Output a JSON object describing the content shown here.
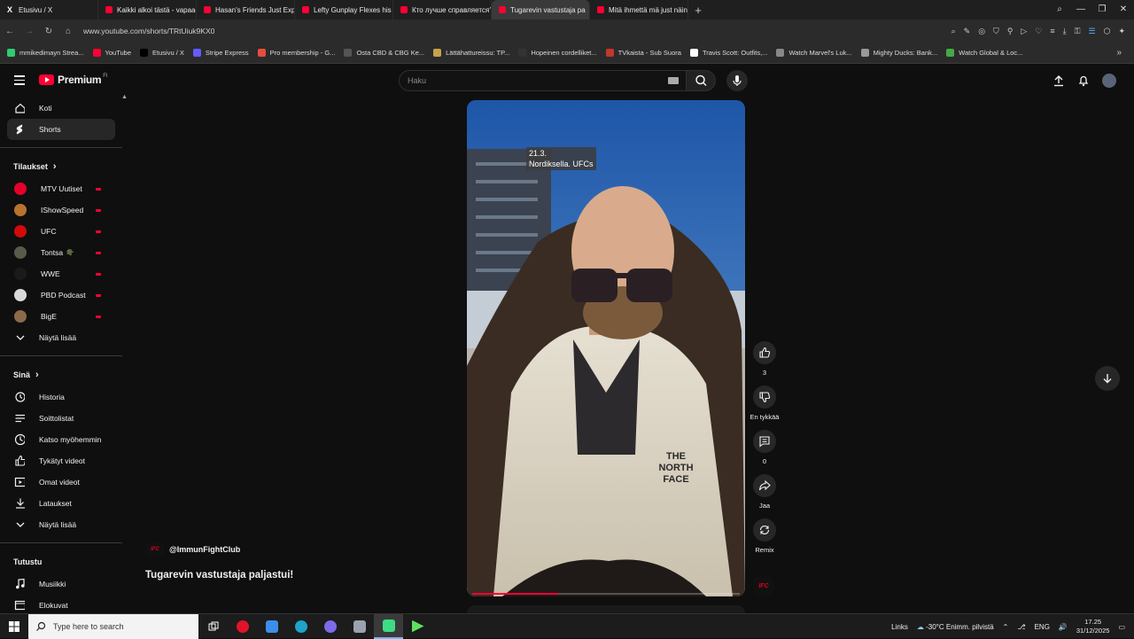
{
  "browser": {
    "tabs": [
      {
        "label": "Etusivu / X",
        "icon": "x-logo-icon"
      },
      {
        "label": "Kaikki alkoi tästä - vapaaottelu",
        "icon": "youtube-icon"
      },
      {
        "label": "Hasan's Friends Just Exposed",
        "icon": "youtube-icon"
      },
      {
        "label": "Lefty Gunplay Flexes his C",
        "icon": "youtube-icon"
      },
      {
        "label": "Кто лучше справляется?",
        "icon": "youtube-icon"
      },
      {
        "label": "Tugarevin vastustaja pa",
        "icon": "youtube-icon",
        "active": true
      },
      {
        "label": "Mitä ihmettä mä just näin",
        "icon": "youtube-icon"
      }
    ],
    "url": "www.youtube.com/shorts/TRtUiuk9KX0",
    "bookmarks": [
      {
        "label": "mmikedimayn Strea...",
        "color": "#2ecc71"
      },
      {
        "label": "YouTube",
        "color": "#ff0033"
      },
      {
        "label": "Etusivu / X",
        "color": "#000000"
      },
      {
        "label": "Stripe Express",
        "color": "#635bff"
      },
      {
        "label": "Pro membership - G...",
        "color": "#e74c3c"
      },
      {
        "label": "Osta CBD & CBG Ke...",
        "color": "#555555"
      },
      {
        "label": "Lättähattureissu: TP...",
        "color": "#c8a24a"
      },
      {
        "label": "Hopeinen cordelliket...",
        "color": "#333333"
      },
      {
        "label": "TVkaista - Sub Suora",
        "color": "#c0392b"
      },
      {
        "label": "Travis Scott: Outfits,...",
        "color": "#ffffff"
      },
      {
        "label": "Watch Marvel's Luk...",
        "color": "#888888"
      },
      {
        "label": "Mighty Ducks: Bank...",
        "color": "#999999"
      },
      {
        "label": "Watch Global & Loc...",
        "color": "#44aa44"
      }
    ]
  },
  "header": {
    "logo_text": "Premium",
    "region": "FI",
    "search_placeholder": "Haku"
  },
  "sidebar": {
    "main": [
      {
        "label": "Koti",
        "icon": "home-icon"
      },
      {
        "label": "Shorts",
        "icon": "shorts-icon",
        "active": true
      }
    ],
    "subscriptions_title": "Tilaukset",
    "subscriptions": [
      {
        "label": "MTV Uutiset",
        "color": "#e4002b"
      },
      {
        "label": "IShowSpeed",
        "color": "#b8742f"
      },
      {
        "label": "UFC",
        "color": "#d20a0a"
      },
      {
        "label": "Tontsa",
        "color": "#5a5a4a",
        "badge": "🪖"
      },
      {
        "label": "WWE",
        "color": "#1a1a1a"
      },
      {
        "label": "PBD Podcast",
        "color": "#d9d9d9"
      },
      {
        "label": "BigE",
        "color": "#8a6a4a"
      }
    ],
    "show_more": "Näytä lisää",
    "you_title": "Sinä",
    "you": [
      {
        "label": "Historia",
        "icon": "history-icon"
      },
      {
        "label": "Soittolistat",
        "icon": "playlist-icon"
      },
      {
        "label": "Katso myöhemmin",
        "icon": "clock-icon"
      },
      {
        "label": "Tykätyt videot",
        "icon": "like-icon"
      },
      {
        "label": "Omat videot",
        "icon": "video-icon"
      },
      {
        "label": "Lataukset",
        "icon": "download-icon"
      }
    ],
    "show_more_2": "Näytä lisää",
    "explore_title": "Tutustu",
    "explore": [
      {
        "label": "Musiikki",
        "icon": "music-icon"
      },
      {
        "label": "Elokuvat",
        "icon": "film-icon"
      }
    ]
  },
  "short": {
    "caption_line1": "21.3.",
    "caption_line2": "Nordiksella. UFCs",
    "channel": "@ImmunFightClub",
    "channel_logo": "IFC",
    "title": "Tugarevin vastustaja paljastui!",
    "progress": 0.32,
    "actions": {
      "likes": "3",
      "dislike": "En tykkää",
      "comments": "0",
      "share": "Jaa",
      "remix": "Remix"
    }
  },
  "taskbar": {
    "search_placeholder": "Type here to search",
    "links": "Links",
    "weather": "-30°C  Enimm. pilvistä",
    "lang": "ENG",
    "time": "17.25",
    "date": "31/12/2025"
  }
}
